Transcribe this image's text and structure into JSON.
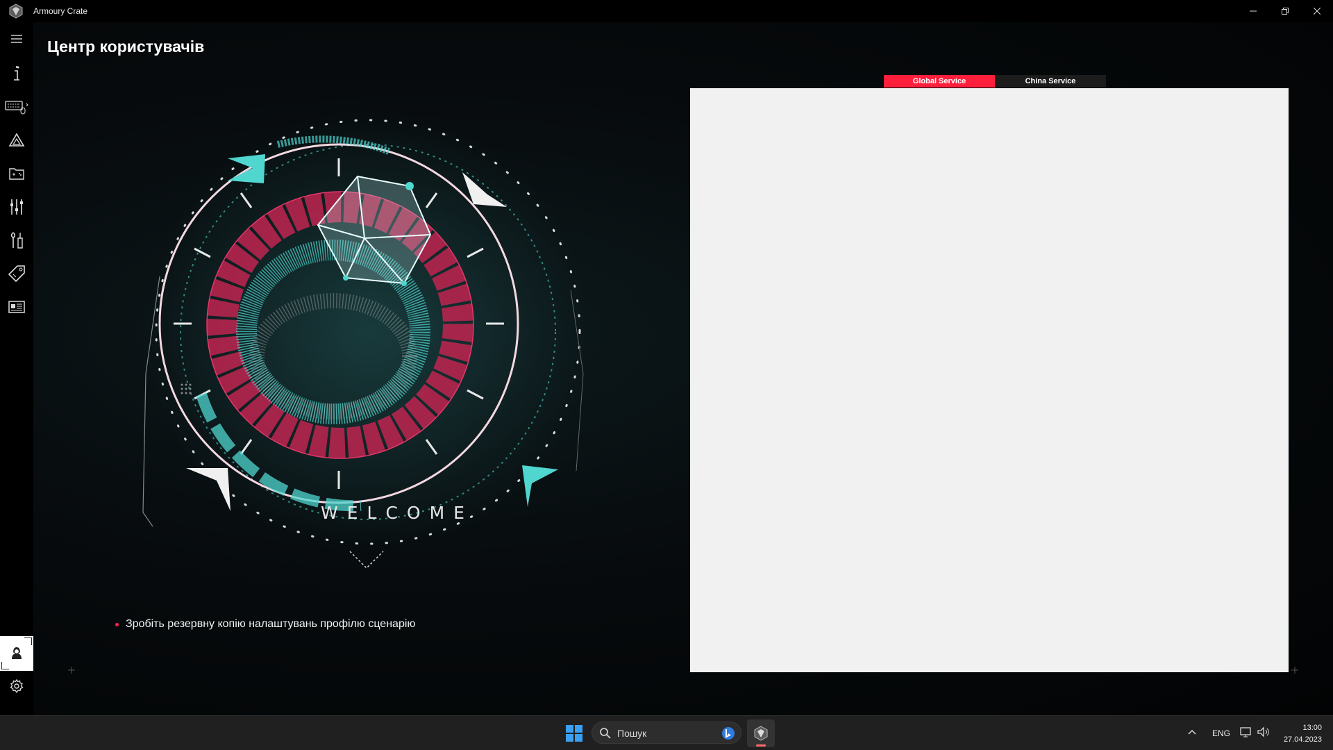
{
  "window": {
    "title": "Armoury Crate",
    "controls": [
      "minimize",
      "restore",
      "close"
    ]
  },
  "sidebar": {
    "items": [
      {
        "name": "menu-icon"
      },
      {
        "name": "device-info-icon"
      },
      {
        "name": "keyboard-icon"
      },
      {
        "name": "aura-sync-icon"
      },
      {
        "name": "game-library-icon"
      },
      {
        "name": "scenario-profiles-icon"
      },
      {
        "name": "tools-icon"
      },
      {
        "name": "deals-icon"
      },
      {
        "name": "news-icon"
      }
    ],
    "user_center": "user-icon",
    "settings": "gear-icon"
  },
  "main": {
    "page_title": "Центр користувачів",
    "welcome_text": "WELCOME",
    "backup_tip": "Зробіть резервну копію налаштувань профілю сценарію",
    "service_tabs": [
      {
        "label": "Global Service",
        "active": true
      },
      {
        "label": "China Service",
        "active": false
      }
    ],
    "login_panel_color": "#f1f1f1"
  },
  "taskbar": {
    "search_placeholder": "Пошук",
    "language": "ENG",
    "time": "13:00",
    "date": "27.04.2023"
  },
  "colors": {
    "accent_red": "#ff1f3d",
    "teal": "#4fd6cf",
    "magenta": "#d02a55"
  }
}
